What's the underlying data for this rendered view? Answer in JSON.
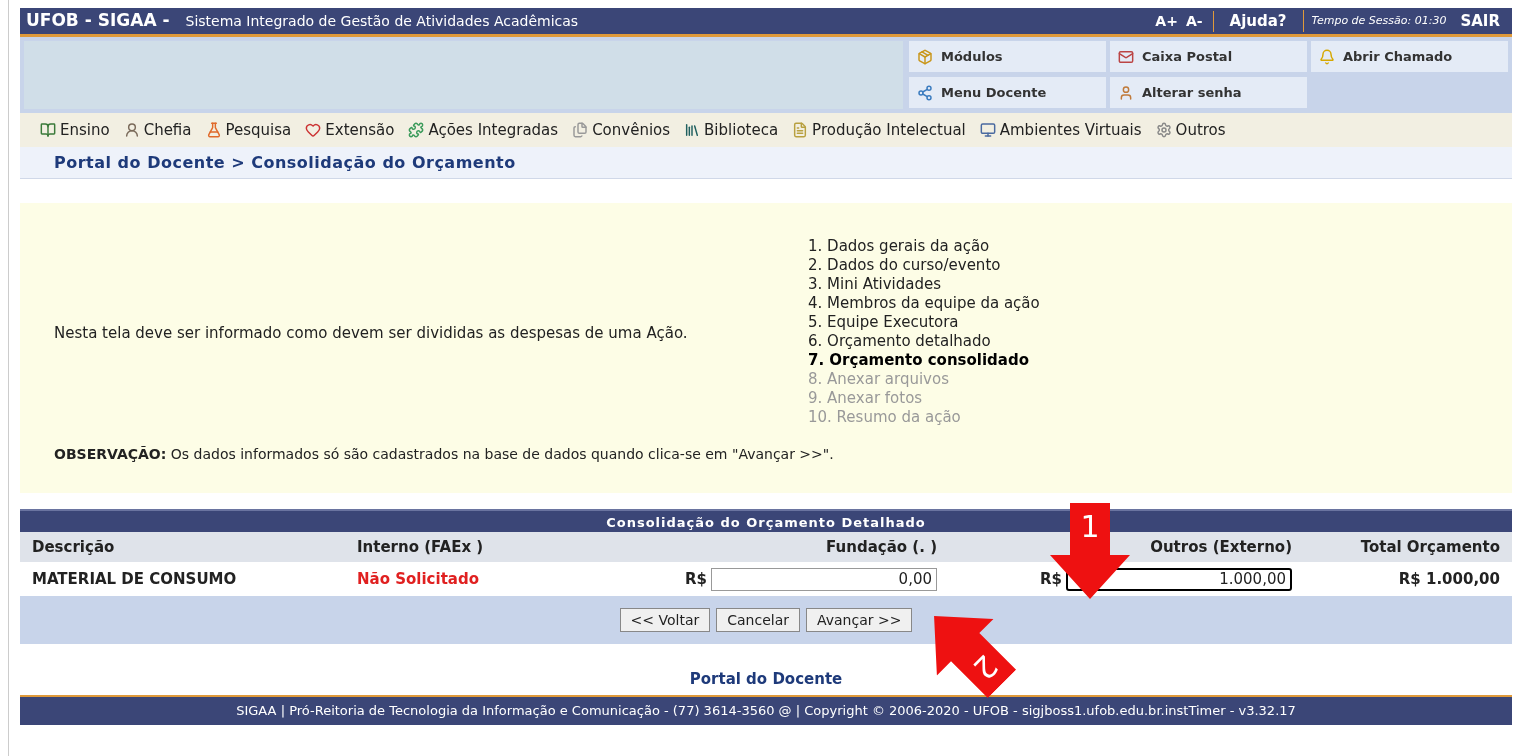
{
  "header": {
    "brand": "UFOB - SIGAA -",
    "subtitle": "Sistema Integrado de Gestão de Atividades Acadêmicas",
    "font_up": "A+",
    "font_down": "A-",
    "help": "Ajuda?",
    "session": "Tempo de Sessão: 01:30",
    "logout": "SAIR"
  },
  "shortcuts": [
    "Módulos",
    "Caixa Postal",
    "Abrir Chamado",
    "Menu Docente",
    "Alterar senha"
  ],
  "menu": [
    "Ensino",
    "Chefia",
    "Pesquisa",
    "Extensão",
    "Ações Integradas",
    "Convênios",
    "Biblioteca",
    "Produção Intelectual",
    "Ambientes Virtuais",
    "Outros"
  ],
  "breadcrumb": "Portal do Docente > Consolidação do Orçamento",
  "info": {
    "text": "Nesta tela deve ser informado como devem ser divididas as despesas de uma Ação.",
    "steps": [
      {
        "label": "1. Dados gerais da ação",
        "selected": false,
        "disabled": false
      },
      {
        "label": "2. Dados do curso/evento",
        "selected": false,
        "disabled": false
      },
      {
        "label": "3. Mini Atividades",
        "selected": false,
        "disabled": false
      },
      {
        "label": "4. Membros da equipe da ação",
        "selected": false,
        "disabled": false
      },
      {
        "label": "5. Equipe Executora",
        "selected": false,
        "disabled": false
      },
      {
        "label": "6. Orçamento detalhado",
        "selected": false,
        "disabled": false
      },
      {
        "label": "7. Orçamento consolidado",
        "selected": true,
        "disabled": false
      },
      {
        "label": "8. Anexar arquivos",
        "selected": false,
        "disabled": true
      },
      {
        "label": "9. Anexar fotos",
        "selected": false,
        "disabled": true
      },
      {
        "label": "10. Resumo da ação",
        "selected": false,
        "disabled": true
      }
    ],
    "note": "**OBSERVAÇÃO:** Os dados informados só são cadastrados na base de dados quando clica-se em \"Avançar >>\"."
  },
  "table": {
    "title": "Consolidação do Orçamento Detalhado",
    "columns": [
      "Descrição",
      "Interno (FAEx )",
      "Fundação (. )",
      "Outros (Externo)",
      "Total Orçamento"
    ],
    "rows": [
      {
        "description": "MATERIAL DE CONSUMO",
        "internal": "Não Solicitado",
        "foundation_currency": "R$",
        "foundation": "0,00",
        "foundation_focused": false,
        "external_currency": "R$",
        "external": "1.000,00",
        "external_focused": true,
        "total": "R$ 1.000,00"
      }
    ]
  },
  "buttons": [
    "<< Voltar",
    "Cancelar",
    "Avançar >>"
  ],
  "footer_link": "Portal do Docente",
  "footer": "SIGAA | Pró-Reitoria de Tecnologia da Informação e Comunicação - (77) 3614-3560 @ | Copyright © 2006-2020 - UFOB - sigjboss1.ufob.edu.br.instTimer - v3.32.17",
  "annotations": [
    "1",
    "2"
  ]
}
